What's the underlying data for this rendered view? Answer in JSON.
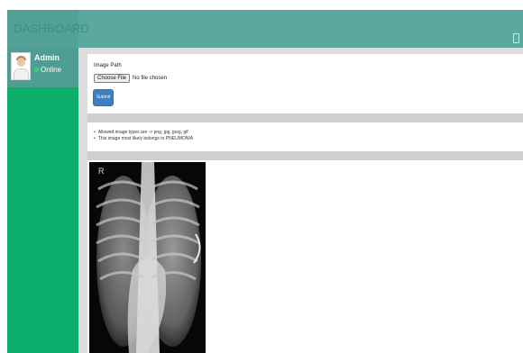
{
  "header": {
    "brand": "DASHBOARD",
    "right_icon": "window-icon"
  },
  "user": {
    "name": "Admin",
    "status": "Online",
    "avatar_icon": "doctor-avatar"
  },
  "upload": {
    "label": "Image Path",
    "choose_button": "Choose File",
    "file_status": "No file chosen",
    "submit_label": "Submit"
  },
  "info": {
    "items": [
      "Allowed image types are -> png, jpg, jpeg, gif",
      "This image most likely belongs to PNEUMONIA"
    ]
  },
  "xray": {
    "marker": "R"
  },
  "colors": {
    "topbar": "#5aa89f",
    "sidebar": "#0dae6b",
    "submit": "#3c7fc2"
  }
}
